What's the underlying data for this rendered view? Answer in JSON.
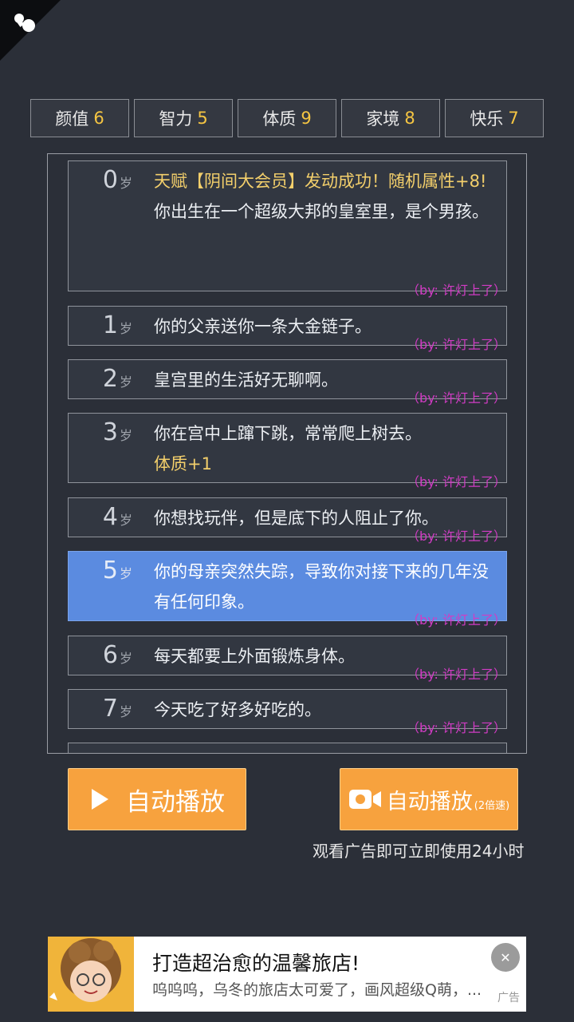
{
  "stats": [
    {
      "label": "颜值",
      "value": "6"
    },
    {
      "label": "智力",
      "value": "5"
    },
    {
      "label": "体质",
      "value": "9"
    },
    {
      "label": "家境",
      "value": "8"
    },
    {
      "label": "快乐",
      "value": "7"
    }
  ],
  "age_unit": "岁",
  "by_tag": "（by: 许灯上了）",
  "entries": [
    {
      "age": "0",
      "line1": "天赋【阴间大会员】发动成功！随机属性+8!",
      "line2": "你出生在一个超级大邦的皇室里，是个男孩。"
    },
    {
      "age": "1",
      "line1": "你的父亲送你一条大金链子。"
    },
    {
      "age": "2",
      "line1": "皇宫里的生活好无聊啊。"
    },
    {
      "age": "3",
      "line1": "你在宫中上蹿下跳，常常爬上树去。",
      "line2": "体质+1"
    },
    {
      "age": "4",
      "line1": "你想找玩伴，但是底下的人阻止了你。"
    },
    {
      "age": "5",
      "line1": "你的母亲突然失踪，导致你对接下来的几年没有任何印象。"
    },
    {
      "age": "6",
      "line1": "每天都要上外面锻炼身体。"
    },
    {
      "age": "7",
      "line1": "今天吃了好多好吃的。"
    }
  ],
  "buttons": {
    "auto_play": "自动播放",
    "auto_play_fast": "自动播放",
    "auto_play_fast_suffix": "(2倍速)",
    "ad_note": "观看广告即可立即使用24小时"
  },
  "banner": {
    "title": "打造超治愈的温馨旅店!",
    "subtitle": "呜呜呜，乌冬的旅店太可爱了，画风超级Q萌，...",
    "tag": "广告",
    "close": "✕"
  },
  "colors": {
    "accent": "#f7a23e",
    "highlight": "#5b8be0",
    "gold": "#f5c542",
    "by_tag": "#d13cc4"
  }
}
